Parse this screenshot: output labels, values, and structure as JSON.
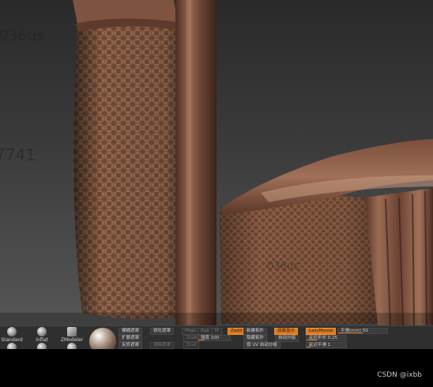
{
  "watermarks": [
    "036us",
    "7741",
    "036us"
  ],
  "brushes": [
    {
      "label": "Standard"
    },
    {
      "label": "Inflat"
    },
    {
      "label": "ZModeler"
    },
    {
      "label": ""
    },
    {
      "label": ""
    },
    {
      "label": ""
    }
  ],
  "toolbar": {
    "buttons": [
      {
        "id": "mask-soften",
        "label": "模糊遮罩"
      },
      {
        "id": "mask-sharpen",
        "label": "锐化遮罩"
      },
      {
        "id": "mask-grow",
        "label": "扩展遮罩"
      },
      {
        "id": "mask-invert",
        "label": "反转遮罩"
      },
      {
        "id": "mask-clear",
        "label": "清除遮罩"
      },
      {
        "id": "topology-new",
        "label": "新建拓扑"
      },
      {
        "id": "topology-hide",
        "label": "隐藏拓扑"
      },
      {
        "id": "auto-group",
        "label": "自动分组"
      },
      {
        "id": "uv-auto-group",
        "label": "按 UV 自动分组"
      },
      {
        "id": "solo-mode",
        "label": "双面显示"
      },
      {
        "id": "lazymouse",
        "label": "LazyMouse"
      }
    ],
    "sliders": [
      {
        "id": "radius",
        "label": "平滑(mm) 50",
        "level": 0.5
      },
      {
        "id": "lazy-step",
        "label": "延迟步长 0.25",
        "level": 0.25
      },
      {
        "id": "lazy-smooth",
        "label": "延迟平滑 1",
        "level": 0.1
      },
      {
        "id": "intensity",
        "label": "强度 100",
        "level": 0.2
      }
    ],
    "toggles": [
      "Mrgb",
      "Rgb",
      "M",
      "Zadd",
      "Zsub",
      "Zcut"
    ],
    "active_toggle": "Zadd"
  },
  "credit": "CSDN @ixbb"
}
